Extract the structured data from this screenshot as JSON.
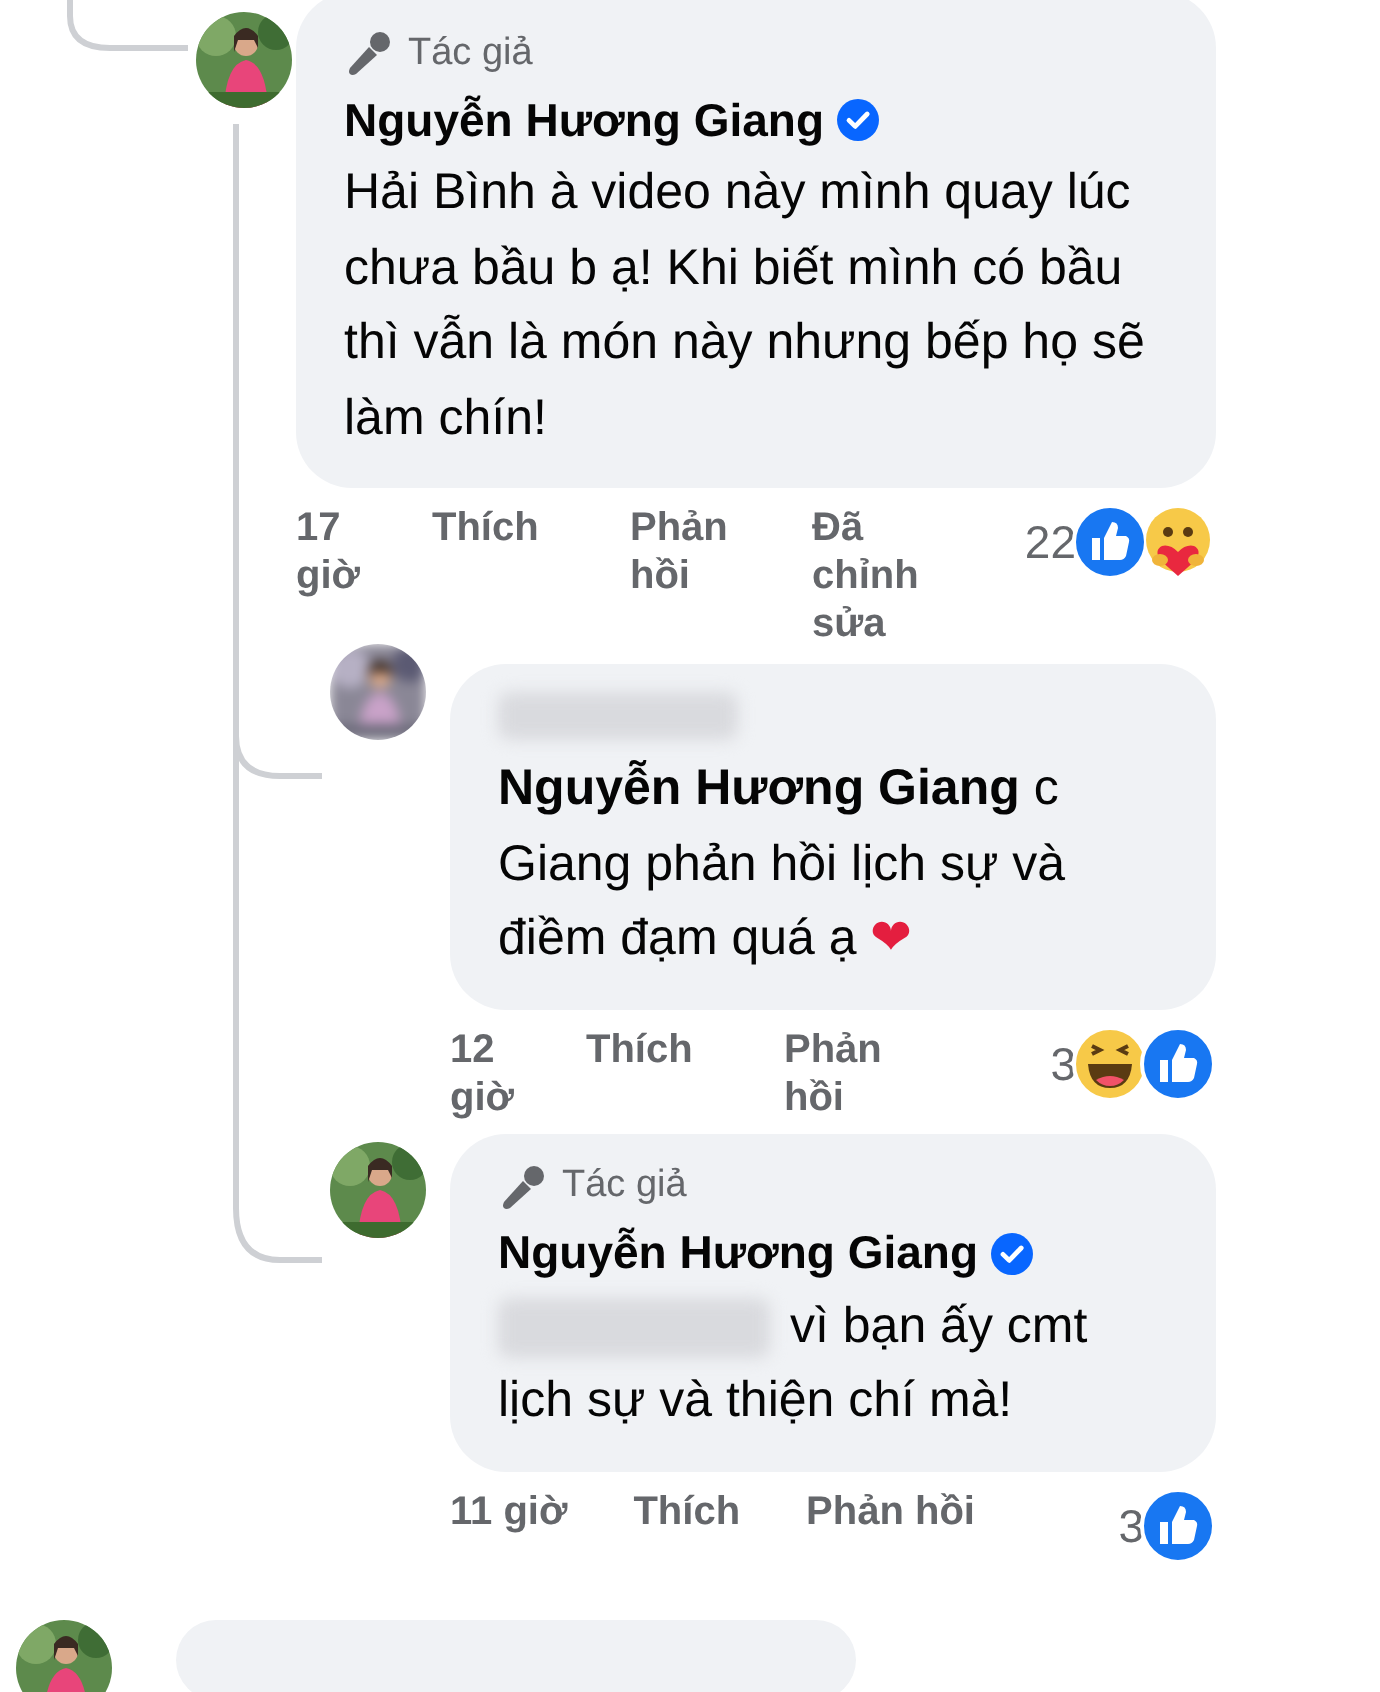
{
  "comments": [
    {
      "avatar_blurred": false,
      "author_badge": "Tác giả",
      "author": "Nguyễn Hương Giang",
      "verified": true,
      "text": "Hải Bình à video này mình quay lúc chưa bầu b ạ! Khi biết mình có bầu thì vẫn là món này nhưng bếp họ sẽ làm chín!",
      "time": "17 giờ",
      "like": "Thích",
      "reply": "Phản hồi",
      "edited": "Đã chỉnh sửa",
      "reaction_count": "22",
      "reactions": [
        {
          "kind": "like"
        },
        {
          "kind": "care"
        }
      ],
      "replies": [
        {
          "avatar_blurred": true,
          "author_redacted": true,
          "text": "**Nguyễn Hương Giang** c Giang phản hồi lịch sự và điềm đạm quá ạ",
          "trailing_emoji": "❤",
          "time": "12 giờ",
          "like": "Thích",
          "reply": "Phản hồi",
          "reaction_count": "3",
          "reactions": [
            {
              "kind": "haha"
            },
            {
              "kind": "like"
            }
          ]
        },
        {
          "avatar_blurred": false,
          "author_badge": "Tác giả",
          "author": "Nguyễn Hương Giang",
          "verified": true,
          "mention_redacted": true,
          "text": "vì bạn ấy cmt lịch sự và thiện chí mà!",
          "time": "11 giờ",
          "like": "Thích",
          "reply": "Phản hồi",
          "reaction_count": "3",
          "reactions": [
            {
              "kind": "like"
            }
          ]
        }
      ]
    }
  ],
  "more_below": true
}
